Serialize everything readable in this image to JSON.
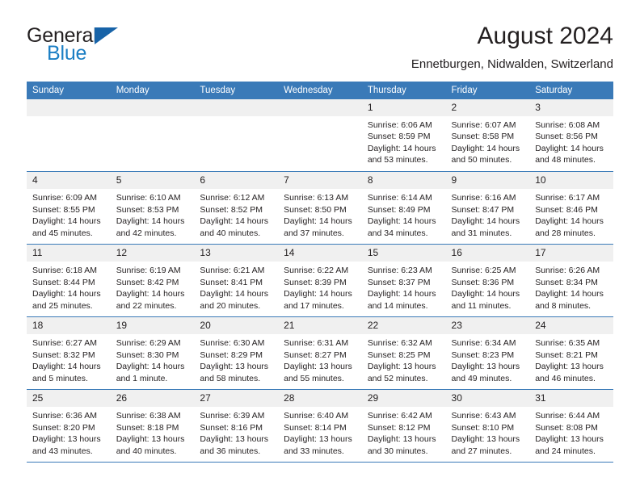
{
  "brand": {
    "name_part1": "General",
    "name_part2": "Blue"
  },
  "header": {
    "title": "August 2024",
    "location": "Ennetburgen, Nidwalden, Switzerland"
  },
  "colors": {
    "header_blue": "#3a7ab8",
    "brand_blue": "#1c7fc4",
    "daynum_bg": "#f0f0f0",
    "text": "#231f20"
  },
  "weekdays": [
    "Sunday",
    "Monday",
    "Tuesday",
    "Wednesday",
    "Thursday",
    "Friday",
    "Saturday"
  ],
  "weeks": [
    [
      {
        "day": "",
        "sunrise": "",
        "sunset": "",
        "daylight1": "",
        "daylight2": ""
      },
      {
        "day": "",
        "sunrise": "",
        "sunset": "",
        "daylight1": "",
        "daylight2": ""
      },
      {
        "day": "",
        "sunrise": "",
        "sunset": "",
        "daylight1": "",
        "daylight2": ""
      },
      {
        "day": "",
        "sunrise": "",
        "sunset": "",
        "daylight1": "",
        "daylight2": ""
      },
      {
        "day": "1",
        "sunrise": "Sunrise: 6:06 AM",
        "sunset": "Sunset: 8:59 PM",
        "daylight1": "Daylight: 14 hours",
        "daylight2": "and 53 minutes."
      },
      {
        "day": "2",
        "sunrise": "Sunrise: 6:07 AM",
        "sunset": "Sunset: 8:58 PM",
        "daylight1": "Daylight: 14 hours",
        "daylight2": "and 50 minutes."
      },
      {
        "day": "3",
        "sunrise": "Sunrise: 6:08 AM",
        "sunset": "Sunset: 8:56 PM",
        "daylight1": "Daylight: 14 hours",
        "daylight2": "and 48 minutes."
      }
    ],
    [
      {
        "day": "4",
        "sunrise": "Sunrise: 6:09 AM",
        "sunset": "Sunset: 8:55 PM",
        "daylight1": "Daylight: 14 hours",
        "daylight2": "and 45 minutes."
      },
      {
        "day": "5",
        "sunrise": "Sunrise: 6:10 AM",
        "sunset": "Sunset: 8:53 PM",
        "daylight1": "Daylight: 14 hours",
        "daylight2": "and 42 minutes."
      },
      {
        "day": "6",
        "sunrise": "Sunrise: 6:12 AM",
        "sunset": "Sunset: 8:52 PM",
        "daylight1": "Daylight: 14 hours",
        "daylight2": "and 40 minutes."
      },
      {
        "day": "7",
        "sunrise": "Sunrise: 6:13 AM",
        "sunset": "Sunset: 8:50 PM",
        "daylight1": "Daylight: 14 hours",
        "daylight2": "and 37 minutes."
      },
      {
        "day": "8",
        "sunrise": "Sunrise: 6:14 AM",
        "sunset": "Sunset: 8:49 PM",
        "daylight1": "Daylight: 14 hours",
        "daylight2": "and 34 minutes."
      },
      {
        "day": "9",
        "sunrise": "Sunrise: 6:16 AM",
        "sunset": "Sunset: 8:47 PM",
        "daylight1": "Daylight: 14 hours",
        "daylight2": "and 31 minutes."
      },
      {
        "day": "10",
        "sunrise": "Sunrise: 6:17 AM",
        "sunset": "Sunset: 8:46 PM",
        "daylight1": "Daylight: 14 hours",
        "daylight2": "and 28 minutes."
      }
    ],
    [
      {
        "day": "11",
        "sunrise": "Sunrise: 6:18 AM",
        "sunset": "Sunset: 8:44 PM",
        "daylight1": "Daylight: 14 hours",
        "daylight2": "and 25 minutes."
      },
      {
        "day": "12",
        "sunrise": "Sunrise: 6:19 AM",
        "sunset": "Sunset: 8:42 PM",
        "daylight1": "Daylight: 14 hours",
        "daylight2": "and 22 minutes."
      },
      {
        "day": "13",
        "sunrise": "Sunrise: 6:21 AM",
        "sunset": "Sunset: 8:41 PM",
        "daylight1": "Daylight: 14 hours",
        "daylight2": "and 20 minutes."
      },
      {
        "day": "14",
        "sunrise": "Sunrise: 6:22 AM",
        "sunset": "Sunset: 8:39 PM",
        "daylight1": "Daylight: 14 hours",
        "daylight2": "and 17 minutes."
      },
      {
        "day": "15",
        "sunrise": "Sunrise: 6:23 AM",
        "sunset": "Sunset: 8:37 PM",
        "daylight1": "Daylight: 14 hours",
        "daylight2": "and 14 minutes."
      },
      {
        "day": "16",
        "sunrise": "Sunrise: 6:25 AM",
        "sunset": "Sunset: 8:36 PM",
        "daylight1": "Daylight: 14 hours",
        "daylight2": "and 11 minutes."
      },
      {
        "day": "17",
        "sunrise": "Sunrise: 6:26 AM",
        "sunset": "Sunset: 8:34 PM",
        "daylight1": "Daylight: 14 hours",
        "daylight2": "and 8 minutes."
      }
    ],
    [
      {
        "day": "18",
        "sunrise": "Sunrise: 6:27 AM",
        "sunset": "Sunset: 8:32 PM",
        "daylight1": "Daylight: 14 hours",
        "daylight2": "and 5 minutes."
      },
      {
        "day": "19",
        "sunrise": "Sunrise: 6:29 AM",
        "sunset": "Sunset: 8:30 PM",
        "daylight1": "Daylight: 14 hours",
        "daylight2": "and 1 minute."
      },
      {
        "day": "20",
        "sunrise": "Sunrise: 6:30 AM",
        "sunset": "Sunset: 8:29 PM",
        "daylight1": "Daylight: 13 hours",
        "daylight2": "and 58 minutes."
      },
      {
        "day": "21",
        "sunrise": "Sunrise: 6:31 AM",
        "sunset": "Sunset: 8:27 PM",
        "daylight1": "Daylight: 13 hours",
        "daylight2": "and 55 minutes."
      },
      {
        "day": "22",
        "sunrise": "Sunrise: 6:32 AM",
        "sunset": "Sunset: 8:25 PM",
        "daylight1": "Daylight: 13 hours",
        "daylight2": "and 52 minutes."
      },
      {
        "day": "23",
        "sunrise": "Sunrise: 6:34 AM",
        "sunset": "Sunset: 8:23 PM",
        "daylight1": "Daylight: 13 hours",
        "daylight2": "and 49 minutes."
      },
      {
        "day": "24",
        "sunrise": "Sunrise: 6:35 AM",
        "sunset": "Sunset: 8:21 PM",
        "daylight1": "Daylight: 13 hours",
        "daylight2": "and 46 minutes."
      }
    ],
    [
      {
        "day": "25",
        "sunrise": "Sunrise: 6:36 AM",
        "sunset": "Sunset: 8:20 PM",
        "daylight1": "Daylight: 13 hours",
        "daylight2": "and 43 minutes."
      },
      {
        "day": "26",
        "sunrise": "Sunrise: 6:38 AM",
        "sunset": "Sunset: 8:18 PM",
        "daylight1": "Daylight: 13 hours",
        "daylight2": "and 40 minutes."
      },
      {
        "day": "27",
        "sunrise": "Sunrise: 6:39 AM",
        "sunset": "Sunset: 8:16 PM",
        "daylight1": "Daylight: 13 hours",
        "daylight2": "and 36 minutes."
      },
      {
        "day": "28",
        "sunrise": "Sunrise: 6:40 AM",
        "sunset": "Sunset: 8:14 PM",
        "daylight1": "Daylight: 13 hours",
        "daylight2": "and 33 minutes."
      },
      {
        "day": "29",
        "sunrise": "Sunrise: 6:42 AM",
        "sunset": "Sunset: 8:12 PM",
        "daylight1": "Daylight: 13 hours",
        "daylight2": "and 30 minutes."
      },
      {
        "day": "30",
        "sunrise": "Sunrise: 6:43 AM",
        "sunset": "Sunset: 8:10 PM",
        "daylight1": "Daylight: 13 hours",
        "daylight2": "and 27 minutes."
      },
      {
        "day": "31",
        "sunrise": "Sunrise: 6:44 AM",
        "sunset": "Sunset: 8:08 PM",
        "daylight1": "Daylight: 13 hours",
        "daylight2": "and 24 minutes."
      }
    ]
  ]
}
